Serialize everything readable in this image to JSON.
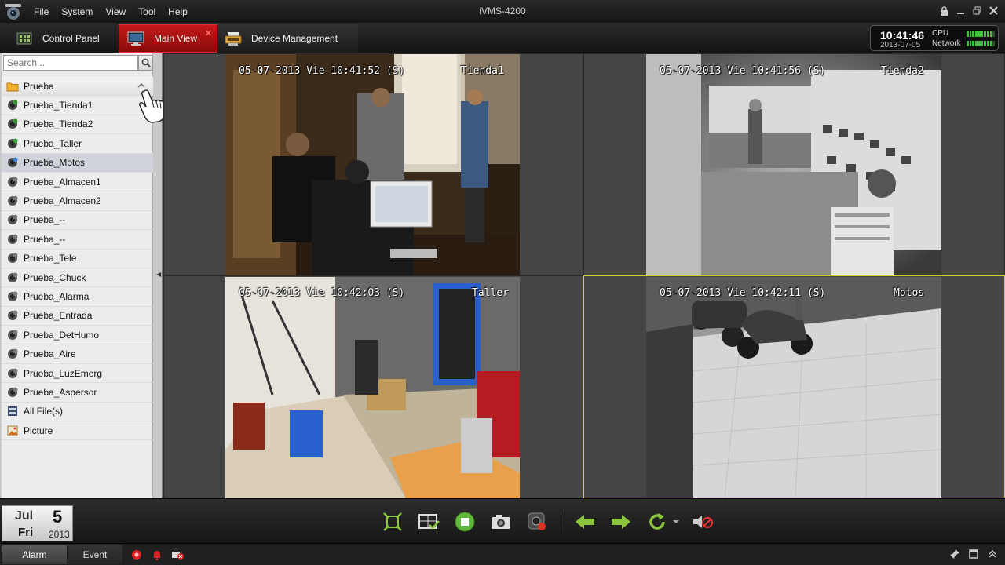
{
  "app": {
    "title": "iVMS-4200",
    "menu": [
      "File",
      "System",
      "View",
      "Tool",
      "Help"
    ]
  },
  "tabs": {
    "control_panel": "Control Panel",
    "main_view": "Main View",
    "device_management": "Device Management",
    "active": "main_view"
  },
  "status": {
    "time": "10:41:46",
    "date": "2013-07-05",
    "cpu_label": "CPU",
    "network_label": "Network",
    "cpu_level": 0.9,
    "network_level": 0.9
  },
  "sidebar": {
    "search_placeholder": "Search...",
    "group": "Prueba",
    "cameras": [
      "Prueba_Tienda1",
      "Prueba_Tienda2",
      "Prueba_Taller",
      "Prueba_Motos",
      "Prueba_Almacen1",
      "Prueba_Almacen2",
      "Prueba_--",
      "Prueba_--",
      "Prueba_Tele",
      "Prueba_Chuck",
      "Prueba_Alarma",
      "Prueba_Entrada",
      "Prueba_DetHumo",
      "Prueba_Aire",
      "Prueba_LuzEmerg",
      "Prueba_Aspersor"
    ],
    "selected_camera": "Prueba_Motos",
    "extras": [
      "All File(s)",
      "Picture"
    ]
  },
  "feeds": [
    {
      "timestamp": "05-07-2013 Vie 10:41:52 (S)",
      "name": "Tienda1"
    },
    {
      "timestamp": "05-07-2013 Vie 10:41:56 (S)",
      "name": "Tienda2"
    },
    {
      "timestamp": "05-07-2013 Vie 10:42:03 (S)",
      "name": "Taller"
    },
    {
      "timestamp": "05-07-2013 Vie 10:42:11 (S)",
      "name": "Motos"
    }
  ],
  "active_feed": 3,
  "date_widget": {
    "month": "Jul",
    "day": "5",
    "weekday": "Fri",
    "year": "2013"
  },
  "statusbar": {
    "alarm": "Alarm",
    "event": "Event"
  },
  "icons": {
    "toolbar": [
      "fullscreen-icon",
      "window-layout-icon",
      "stop-all-icon",
      "capture-icon",
      "record-icon",
      "previous-icon",
      "next-icon",
      "auto-switch-icon",
      "auto-switch-dropdown-icon",
      "mute-icon"
    ]
  },
  "colors": {
    "active_tab": "#c41a1a",
    "active_cell_border": "#d8c92c",
    "online_camera": "#3a9a3a"
  }
}
